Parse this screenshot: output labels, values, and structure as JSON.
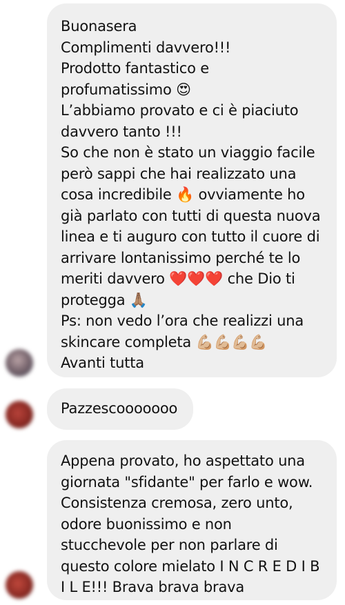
{
  "thread": {
    "messages": [
      {
        "avatar": "blurred-avatar",
        "lines": [
          "Buonasera",
          "Complimenti davvero!!!",
          "Prodotto fantastico e",
          "profumatissimo 😍",
          "L’abbiamo provato e ci è piaciuto",
          "davvero tanto !!!",
          "So che non è stato un viaggio facile",
          "però sappi che hai realizzato una",
          "cosa incredibile 🔥 ovviamente ho",
          "già parlato con tutti di questa nuova",
          "linea e ti auguro con tutto il cuore di",
          "arrivare lontanissimo perché te lo",
          "meriti davvero ❤️❤️❤️ che Dio ti",
          "protegga 🙏🏽",
          "Ps: non vedo l’ora che realizzi una",
          "skincare completa 💪🏼💪🏼💪🏼💪🏼",
          "Avanti tutta"
        ]
      },
      {
        "avatar": "blurred-avatar",
        "lines": [
          "Pazzescooooooo"
        ]
      },
      {
        "avatar": "blurred-avatar",
        "lines": [
          "Appena provato, ho aspettato una",
          "giornata \"sfidante\" per farlo e wow.",
          "Consistenza cremosa, zero unto,",
          "odore buonissimo e non",
          "stucchevole per non parlare di",
          "questo colore mielato I N C R E D I B",
          "I L E!!! Brava brava brava"
        ]
      }
    ]
  }
}
